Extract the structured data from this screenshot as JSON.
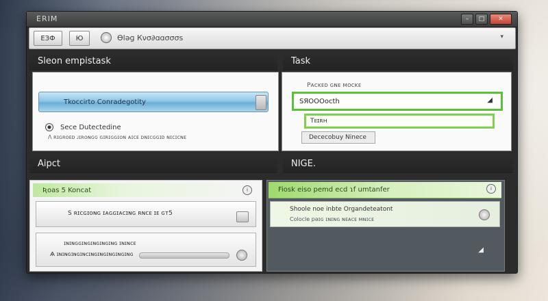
{
  "window": {
    "title": "ERIM",
    "min": "–",
    "max": "□",
    "close": "✕"
  },
  "toolbar": {
    "btn1": "ЕЗФ",
    "btn2": "Ю",
    "address": "Өləɡ Кνσ∂ɑɑσσσѕ",
    "caret": "▾"
  },
  "top_left": {
    "header": "Sleon empistask",
    "bar_label": "Tkoccirto Conradegotity",
    "radio_label": "Sece Dutectedine",
    "desc": "Ʌ ʀɪɢʀᴏᴇᴅ ᴊɪʀᴏɴɢɢ ɢɪʀɪɢɢɪᴏɴ   ᴀɪᴄᴇ ᴅɴɪᴄɢɢɪᴅ ɴɪᴄɪᴄɴᴇ"
  },
  "top_right": {
    "header": "Task",
    "label": "Pᴀᴄᴋᴇᴅ ɢɴᴇ ᴍᴏᴄᴋᴇ",
    "field": "SЯOOOocth",
    "field_caret": "◢",
    "sub1": "Tᴇɪʀʜ",
    "sub2": "Dececobuy Ninece"
  },
  "bottom_left": {
    "header": "Aipct",
    "strip": "Ʀoas 5 Koncat",
    "card1": "S ʀɪᴄɢɪᴏɴɢ ɪᴀɢɢɪᴀᴄɪɴɢ ʀɴᴄᴇ ɪᴇ ɢᴛ5",
    "card2_line1": "ɪɴɪɴɢɢɪɴɢɪɴɢɪɴɢɪɴɢ ɪɴɪɴᴄᴇ",
    "card2_line2": "Ѧ ɪɴɪɴɢɪɴɢɪɴᴄɪɴɢɪɴɢɪɴɢɪɴɢɪɴɢ"
  },
  "bottom_right": {
    "header": "NIGE.",
    "strip": "Fiosk eiso pemd ecd ɿf umtanfer",
    "card_line1": "Shoole noe inbte Organdeteatont",
    "card_line2": "Colocle pəɪɢ ɪɴɪɴɢ ɴᴇᴀᴄᴇ ᴍɴɪᴄᴇ",
    "corner_mark": "◢"
  },
  "colors": {
    "accent_green": "#5bbf3a",
    "accent_blue": "#6aafd6",
    "window_bg": "#2b2c2b",
    "dark_panel": "#525a60"
  },
  "icons": [
    "globe-icon",
    "close-icon",
    "chevron-down-icon",
    "radio-icon",
    "info-icon",
    "caret-icon"
  ]
}
